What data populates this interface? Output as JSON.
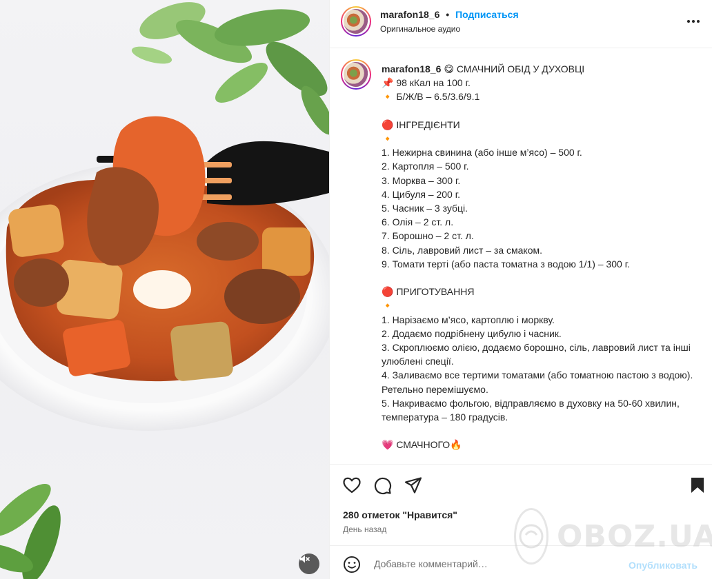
{
  "post": {
    "username": "marafon18_6",
    "dot": "•",
    "follow_label": "Подписаться",
    "audio": "Оригинальное аудио"
  },
  "caption": {
    "username": "marafon18_6",
    "text": "😋 СМАЧНИЙ ОБІД У ДУХОВЦІ\n📌 98 кКал на 100 г.\n🔸 Б/Ж/В – 6.5/3.6/9.1\n\n🔴 ІНГРЕДІЄНТИ\n🔸\n1. Нежирна свинина (або інше м’ясо) – 500 г.\n2. Картопля – 500 г.\n3. Морква – 300 г.\n4. Цибуля – 200 г.\n5. Часник – 3 зубці.\n6. Олія – 2 ст. л.\n7. Борошно – 2 ст. л.\n8. Сіль, лавровий лист – за смаком.\n9. Томати терті (або паста томатна з водою 1/1) – 300 г.\n\n🔴 ПРИГОТУВАННЯ\n🔸\n1. Нарізаємо м’ясо, картоплю і моркву.\n2. Додаємо подрібнену цибулю і часник.\n3. Скроплюємо олією, додаємо борошно, сіль, лавровий лист та інші улюблені спеції.\n4. Заливаємо все тертими томатами (або томатною пастою з водою). Ретельно перемішуємо.\n5. Накриваємо фольгою, відправляємо в духовку на 50-60 хвилин, температура – 180 градусів.\n\n💗 СМАЧНОГО🔥"
  },
  "stats": {
    "likes": "280 отметок \"Нравится\"",
    "time": "День назад"
  },
  "comment": {
    "placeholder": "Добавьте комментарий…",
    "publish_label": "Опубликовать"
  },
  "watermark": {
    "text": "OBOZ.UA"
  },
  "icons": {
    "like": "heart-icon",
    "comment": "comment-icon",
    "share": "send-icon",
    "save": "bookmark-icon",
    "more": "more-options-icon",
    "emoji": "emoji-icon",
    "mute": "sound-off-icon"
  },
  "colors": {
    "accent": "#0095f6",
    "publish_disabled": "#b2dffc",
    "text": "#262626",
    "muted": "#737373"
  }
}
